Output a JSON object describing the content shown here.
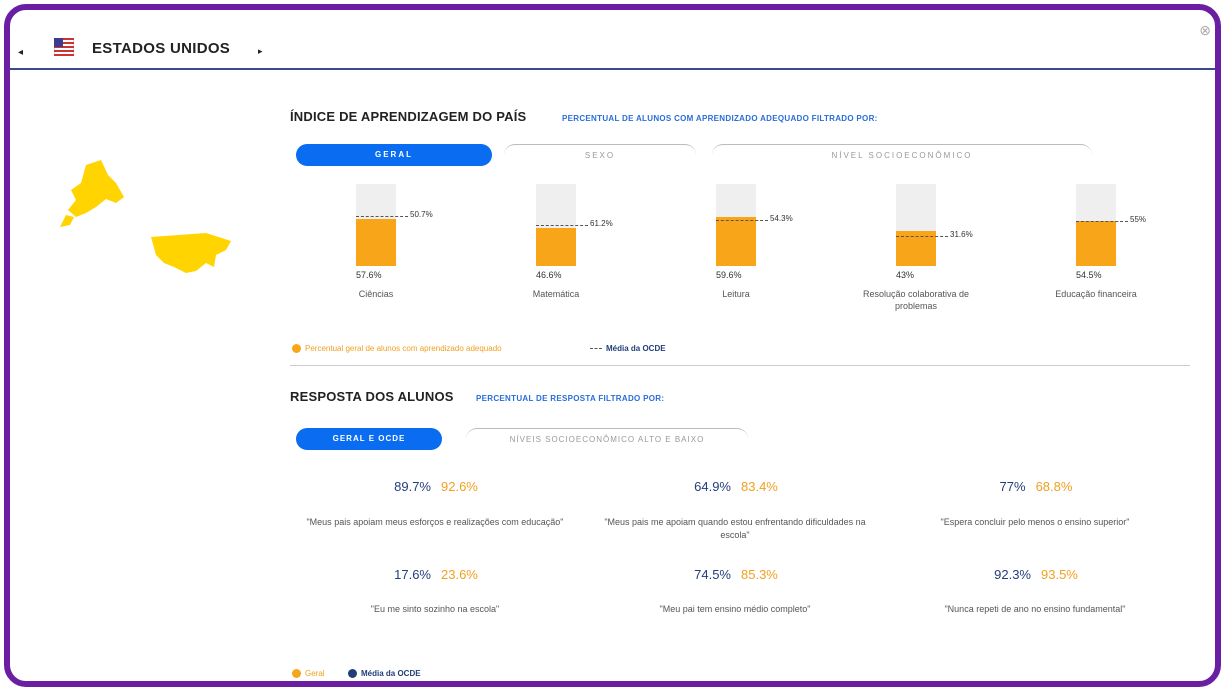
{
  "header": {
    "country": "ESTADOS UNIDOS",
    "prev_arrow": "◂",
    "next_arrow": "▸",
    "close": "⊗"
  },
  "learning": {
    "title": "ÍNDICE DE APRENDIZAGEM DO PAÍS",
    "subtitle": "PERCENTUAL DE ALUNOS COM APRENDIZADO ADEQUADO FILTRADO POR:",
    "tabs": [
      "GERAL",
      "SEXO",
      "NÍVEL SOCIOECONÔMICO"
    ],
    "active_tab": "GERAL",
    "bars": [
      {
        "label": "Ciências",
        "value": 57.6,
        "value_text": "57.6%",
        "oecd": 60.7,
        "oecd_text": "50.7%"
      },
      {
        "label": "Matemática",
        "value": 46.6,
        "value_text": "46.6%",
        "oecd": 50.2,
        "oecd_text": "61.2%"
      },
      {
        "label": "Leitura",
        "value": 59.6,
        "value_text": "59.6%",
        "oecd": 56.3,
        "oecd_text": "54.3%"
      },
      {
        "label": "Resolução colaborativa de problemas",
        "value": 43,
        "value_text": "43%",
        "oecd": 36,
        "oecd_text": "31.6%"
      },
      {
        "label": "Educação financeira",
        "value": 54.5,
        "value_text": "54.5%",
        "oecd": 55,
        "oecd_text": "55%"
      }
    ],
    "legend_value": "Percentual geral de alunos com aprendizado adequado",
    "legend_oecd": "Média da OCDE"
  },
  "answers": {
    "title": "RESPOSTA DOS ALUNOS",
    "subtitle": "PERCENTUAL DE RESPOSTA FILTRADO POR:",
    "tabs": [
      "GERAL E OCDE",
      "NÍVEIS SOCIOECONÔMICO ALTO E BAIXO"
    ],
    "items": [
      {
        "v1": "89.7%",
        "v2": "92.6%",
        "text": "\"Meus pais apoiam meus esforços e realizações com educação\""
      },
      {
        "v1": "64.9%",
        "v2": "83.4%",
        "text": "\"Meus pais me apoiam quando estou enfrentando dificuldades na escola\""
      },
      {
        "v1": "77%",
        "v2": "68.8%",
        "text": "\"Espera concluir pelo menos o ensino superior\""
      },
      {
        "v1": "17.6%",
        "v2": "23.6%",
        "text": "\"Eu me sinto sozinho na escola\""
      },
      {
        "v1": "74.5%",
        "v2": "85.3%",
        "text": "\"Meu pai tem ensino médio completo\""
      },
      {
        "v1": "92.3%",
        "v2": "93.5%",
        "text": "\"Nunca repeti de ano no ensino fundamental\""
      }
    ],
    "legend_geral": "Geral",
    "legend_oecd": "Média da OCDE"
  },
  "colors": {
    "accent": "#0a6cf0",
    "bar": "#f9a51a",
    "frame": "#6a1fa3",
    "oecd": "#223e7a"
  }
}
